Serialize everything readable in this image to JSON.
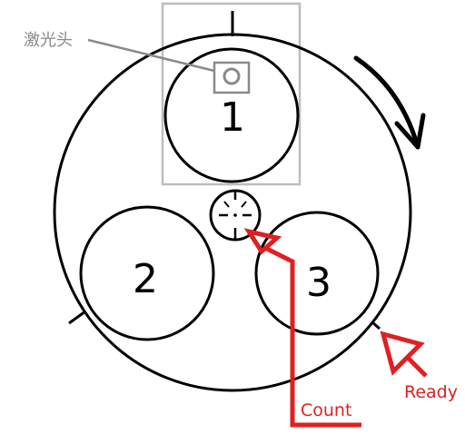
{
  "labels": {
    "laser_head": "激光头",
    "slot_1": "1",
    "slot_2": "2",
    "slot_3": "3",
    "count": "Count",
    "ready": "Ready"
  },
  "colors": {
    "stroke": "#000000",
    "laser_gray": "#8a8a8a",
    "box_gray": "#bdbdbd",
    "annotation_red": "#e02020"
  }
}
